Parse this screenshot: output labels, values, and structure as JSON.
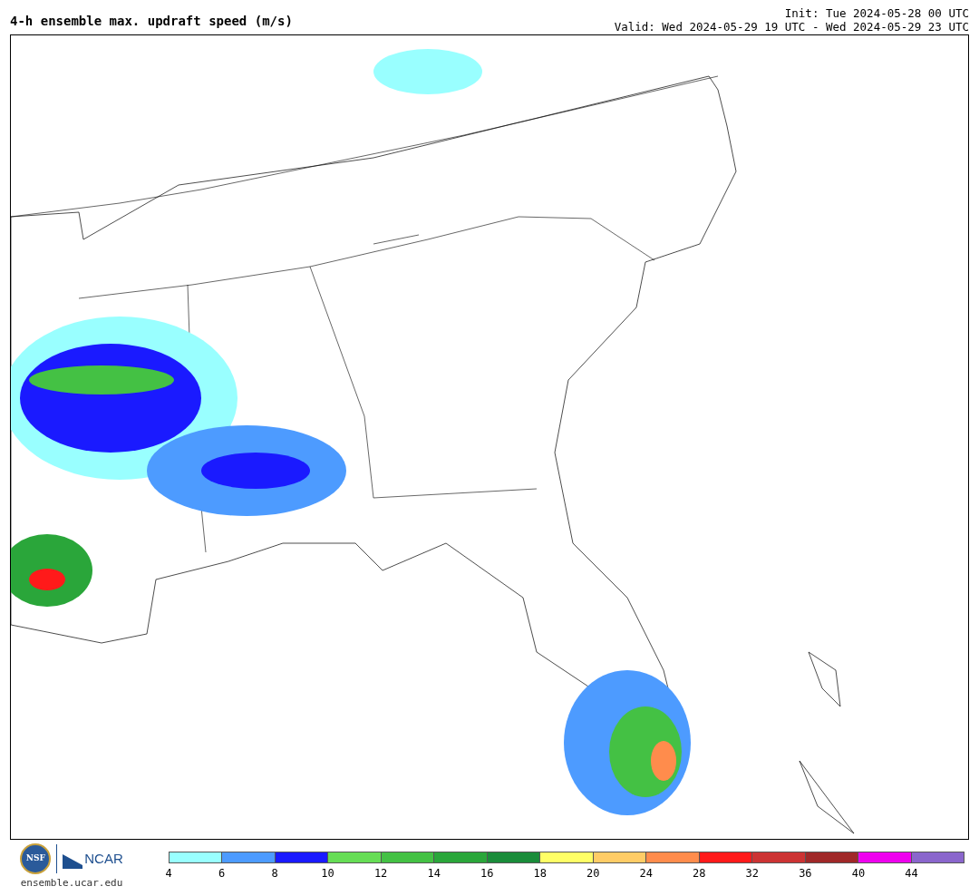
{
  "title": "4-h ensemble max. updraft speed (m/s)",
  "init": "Init: Tue 2024-05-28 00 UTC",
  "valid": "Valid: Wed 2024-05-29 19 UTC - Wed 2024-05-29 23 UTC",
  "logos": {
    "nsf": "NSF",
    "ncar": "NCAR",
    "url": "ensemble.ucar.edu"
  },
  "colorbar": {
    "bins": [
      {
        "label": "4",
        "color": "#99ffff"
      },
      {
        "label": "6",
        "color": "#4d9bff"
      },
      {
        "label": "8",
        "color": "#1a1aff"
      },
      {
        "label": "10",
        "color": "#66dd55"
      },
      {
        "label": "12",
        "color": "#44c144"
      },
      {
        "label": "14",
        "color": "#2aa63a"
      },
      {
        "label": "16",
        "color": "#1a8c3a"
      },
      {
        "label": "18",
        "color": "#ffff66"
      },
      {
        "label": "20",
        "color": "#ffcc66"
      },
      {
        "label": "24",
        "color": "#ff8c4c"
      },
      {
        "label": "28",
        "color": "#ff1a1a"
      },
      {
        "label": "32",
        "color": "#cc3333"
      },
      {
        "label": "36",
        "color": "#a02828"
      },
      {
        "label": "40",
        "color": "#ee00ee"
      },
      {
        "label": "44",
        "color": "#8a66cc"
      }
    ]
  }
}
